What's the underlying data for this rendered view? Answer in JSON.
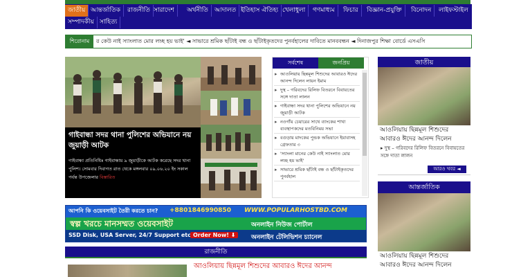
{
  "nav": {
    "row1": [
      "জাতীয়",
      "আন্তর্জাতিক",
      "রাজনীতি",
      "সারাদেশ",
      "অর্থনীতি",
      "আদালত",
      "ইতিহাস ঐতিহ্য",
      "খেলাধুলা",
      "গণমাধ্যম",
      "ফিচার",
      "বিজ্ঞান-প্রযুক্তি",
      "বিনোদন",
      "লাইফস্টাইল"
    ],
    "row2": [
      "সম্পাদকীয়",
      "সাহিত্য"
    ]
  },
  "ticker": {
    "label": "শিরোনাম",
    "text": "র কেউ নাই স্যাংলাত মোর লচ্ছ হয় ভাই'   ◄   সাভারে শ্রমিক ছাঁটাই বন্ধ ও ছাঁটাইকৃতদের পুনর্বহালের দাবিতে মানববন্ধন   ◄   দিনাজপুর শিক্ষা বোর্ডে এসএসি"
  },
  "lead": {
    "headline": "গাইবান্ধা সদর থানা পুলিশের অভিযানে নয় জুয়াড়ী আটক",
    "summary": "গাইবান্ধা প্রতিনিধিঃ গাইবান্ধায় ৯ জুয়াড়ীকে আটক করেছে সদর থানা পুলিশ। সোমবার দিবাগত রাত থেকে মঙ্গলবার ০৯.০৬.২০ ইং সকাল পর্যন্ত উপজেলার",
    "more": "বিস্তারিত"
  },
  "tabs": {
    "latest": "সর্বশেষ",
    "popular": "জনপ্রিয়",
    "items": [
      "আওলিয়ায় ছিন্নমূল শিশুদের আবারও ঈদের আনন্দ দিলেন লায়ন ইমাম",
      "দুস্থ – গরিবদের রিলিফ বিতরনে বিবায়তের সঙ্গে দাতা লালন",
      "গাইবান্ধা সদর থানা পুলিশের অভিযানে নয় জুয়াড়ী আটক",
      "নওগাঁয় চেয়ারের সাথে ব্যাংকের শাখা ব্যবস্থাপকদের মতবিনিময় সভা",
      "বগুড়ায় মাদকের পুন্ডক অভিযানে ইয়াবাসহ গ্রেফতার ৩",
      "'স্যাংলা মানের কেউ নাই স্যাংলাত মোর লচ্ছ হয় ভাই'",
      "সাভারে শ্রমিক ছাঁটাই বন্ধ ও ছাঁটাইকৃতদের পুনর্বহাল"
    ]
  },
  "ad": {
    "question": "আপনি কি ওয়েবসাইট তৈরী করতে চান?",
    "phone": "+8801846990850",
    "site": "WWW.POPULARHOSTBD.COM",
    "slogan": "স্বল্প খরচে মানসম্মত ওয়েবসাইট",
    "feature1": "অনলাইন নিউজ পোর্টাল",
    "feature2": "অনলাইন টেলিভিশন চ্যানেল",
    "specs": "SSD Disk, USA Server, 24/7 Support etc.",
    "order": "Order Now! ⬇"
  },
  "politics": {
    "section_title": "রাজনীতি",
    "headline": "আওলিয়ায় ছিন্নমূল শিশুদের আবারও ঈদের আনন্দ"
  },
  "sidebar": {
    "national": {
      "title": "জাতীয়",
      "story": "আওলিয়ায় ছিন্নমূল শিশুদের আবারও ঈদের আনন্দ দিলেন",
      "link": "দুস্থ – গরিবদের রিলিফ বিতরনে বিবায়তের সঙ্গে দাতা লালন",
      "more": "আরও খবর ◄"
    },
    "international": {
      "title": "আন্তর্জাতিক",
      "story": "আওলিয়ায় ছিন্নমূল শিশুদের আবারও ঈদের আনন্দ দিলেন"
    }
  }
}
